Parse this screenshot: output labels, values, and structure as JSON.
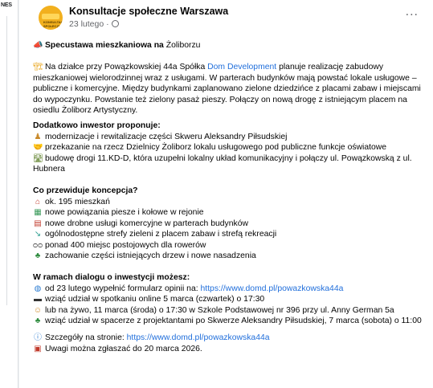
{
  "sidebar": {
    "fragment": "NES"
  },
  "post": {
    "page_name": "Konsultacje społeczne Warszawa",
    "date": "23 lutego ·",
    "avatar_label": "KONSULTACJE SPOŁECZNE",
    "more_label": "...",
    "title_icon": "megaphone-icon",
    "title_bold": "Specustawa mieszkaniowa na",
    "title_rest": " Żoliborzu",
    "intro": {
      "icon": "crane-icon",
      "before_link": "Na działce przy Powązkowskiej 44a Spółka ",
      "link": "Dom Development",
      "after_link": " planuje realizację zabudowy mieszkaniowej wielorodzinnej wraz z usługami. W parterach budynków mają powstać lokale usługowe – publiczne i komercyjne. Między budynkami zaplanowano zielone dziedzińce z placami zabaw i miejscami do wypoczynku. Powstanie też zielony pasaż pieszy. Połączy on nową drogę z istniejącym placem na osiedlu Żoliborz Artystyczny."
    },
    "section1": {
      "heading": "Dodatkowo inwestor proponuje:",
      "items": [
        {
          "icon": "monument-icon",
          "text": "modernizacje i rewitalizacje części Skweru Aleksandry Piłsudskiej"
        },
        {
          "icon": "handshake-icon",
          "text": "przekazanie na rzecz Dzielnicy Żoliborz lokalu usługowego pod publiczne funkcje oświatowe"
        },
        {
          "icon": "road-icon",
          "text": "budowę drogi 11.KD-D, która uzupełni lokalny układ komunikacyjny i połączy ul. Powązkowską z ul. Hubnera"
        }
      ]
    },
    "section2": {
      "heading": "Co przewiduje koncepcja?",
      "items": [
        {
          "icon": "house-icon",
          "text": "ok. 195 mieszkań"
        },
        {
          "icon": "road-network-icon",
          "text": "nowe powiązania piesze i kołowe w rejonie"
        },
        {
          "icon": "shop-icon",
          "text": "nowe drobne usługi komercyjne w parterach budynków"
        },
        {
          "icon": "slide-icon",
          "text": "ogólnodostępne strefy zieleni z placem zabaw i strefą rekreacji"
        },
        {
          "icon": "bicycle-icon",
          "text": "ponad 400 miejsc postojowych dla rowerów"
        },
        {
          "icon": "tree-icon",
          "text": "zachowanie części istniejących drzew i nowe nasadzenia"
        }
      ]
    },
    "section3": {
      "heading": "W ramach dialogu o inwestycji możesz:",
      "items": [
        {
          "icon": "globe-icon",
          "text": "od 23 lutego wypełnić formularz opinii na: ",
          "link": "https://www.domd.pl/powazkowska44a"
        },
        {
          "icon": "laptop-icon",
          "text": "wziąć udział w spotkaniu online 5 marca (czwartek) o 17:30"
        },
        {
          "icon": "people-icon",
          "text": "lub na żywo, 11 marca (środa) o 17:30 w Szkole Podstawowej nr 396 przy ul. Anny German 5a"
        },
        {
          "icon": "tree-icon",
          "text": "wziąć udział w spacerze z projektantami po Skwerze Aleksandry Piłsudskiej, 7 marca (sobota) o 11:00"
        }
      ]
    },
    "footer": [
      {
        "icon": "info-icon",
        "text": "Szczegóły na stronie: ",
        "link": "https://www.domd.pl/powazkowska44a"
      },
      {
        "icon": "calendar-icon",
        "text": "Uwagi można zgłaszać do 20 marca 2026."
      }
    ]
  }
}
